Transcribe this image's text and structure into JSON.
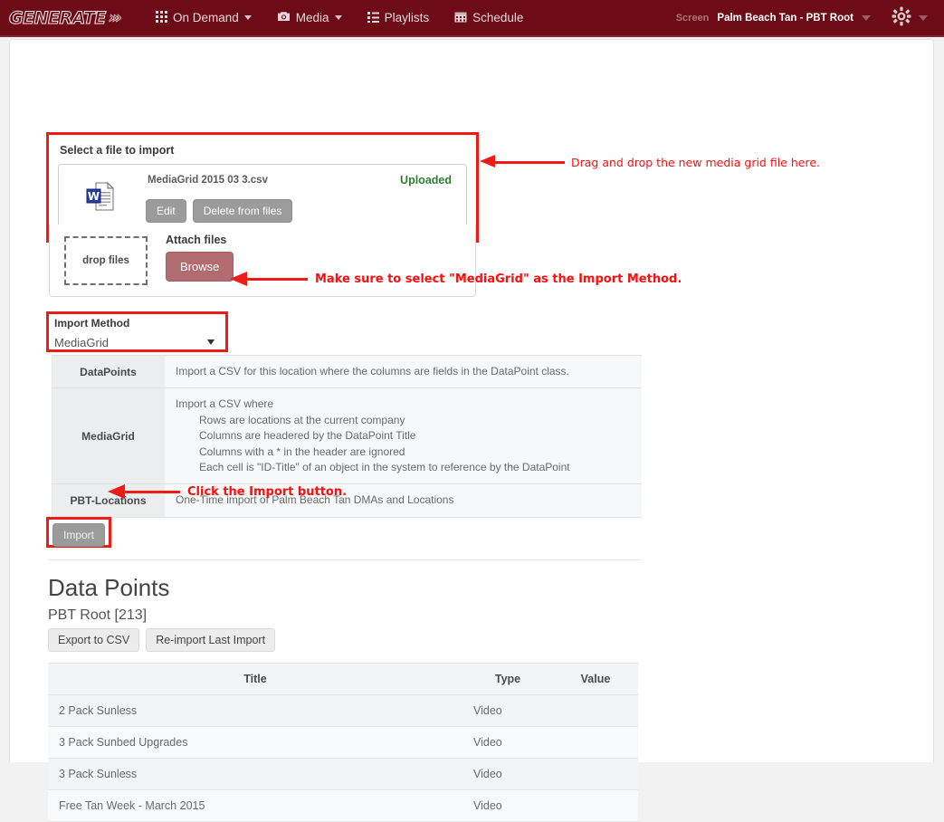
{
  "navbar": {
    "brand": "GENERATE",
    "brand_chevrons": "»›",
    "items": [
      {
        "label": "On Demand",
        "icon": "grid-icon",
        "caret": true
      },
      {
        "label": "Media",
        "icon": "camera-icon",
        "caret": true
      },
      {
        "label": "Playlists",
        "icon": "list-icon",
        "caret": false
      },
      {
        "label": "Schedule",
        "icon": "calendar-icon",
        "caret": false
      }
    ],
    "screen_label": "Screen",
    "screen_value": "Palm Beach Tan - PBT Root",
    "gear_icon": "gear-icon"
  },
  "file_panel": {
    "title": "Select a file to import",
    "file": {
      "name": "MediaGrid 2015 03 3.csv",
      "status": "Uploaded",
      "icon": "word-document-icon",
      "edit_label": "Edit",
      "delete_label": "Delete from files"
    },
    "attach": {
      "dropzone_label": "drop files",
      "attach_label": "Attach files",
      "browse_label": "Browse"
    }
  },
  "import_method": {
    "label": "Import Method",
    "selected": "MediaGrid",
    "options": [
      "DataPoints",
      "MediaGrid",
      "PBT-Locations"
    ]
  },
  "method_descriptions": [
    {
      "name": "DataPoints",
      "lines": [
        "Import a CSV for this location where the columns are fields in the DataPoint class."
      ],
      "indented": []
    },
    {
      "name": "MediaGrid",
      "lines": [
        "Import a CSV where"
      ],
      "indented": [
        "Rows are locations at the current company",
        "Columns are headered by the DataPoint Title",
        "Columns with a * in the header are ignored",
        "Each cell is \"ID-Title\" of an object in the system to reference by the DataPoint"
      ]
    },
    {
      "name": "PBT-Locations",
      "lines": [
        "One-Time import of Palm Beach Tan DMAs and Locations"
      ],
      "indented": []
    }
  ],
  "import_button": {
    "label": "Import"
  },
  "data_points": {
    "title": "Data Points",
    "subtitle": "PBT Root [213]",
    "export_label": "Export to CSV",
    "reimport_label": "Re-import Last Import",
    "columns": [
      "Title",
      "Type",
      "Value"
    ],
    "rows": [
      {
        "title": "2 Pack Sunless",
        "type": "Video",
        "value": ""
      },
      {
        "title": "3 Pack Sunbed Upgrades",
        "type": "Video",
        "value": ""
      },
      {
        "title": "3 Pack Sunless",
        "type": "Video",
        "value": ""
      },
      {
        "title": "Free Tan Week - March 2015",
        "type": "Video",
        "value": ""
      }
    ]
  },
  "annotations": [
    {
      "text": "Drag and drop the new media grid file here."
    },
    {
      "text": "Make sure to select \"MediaGrid\" as the Import Method."
    },
    {
      "text": "Click the Import button."
    }
  ],
  "colors": {
    "navbar": "#6d0b17",
    "annotation_red": "#fd0d0d",
    "highlight_red": "#ee1c17",
    "uploaded_green": "#2f7d32",
    "browse_button": "#b26b6f"
  }
}
